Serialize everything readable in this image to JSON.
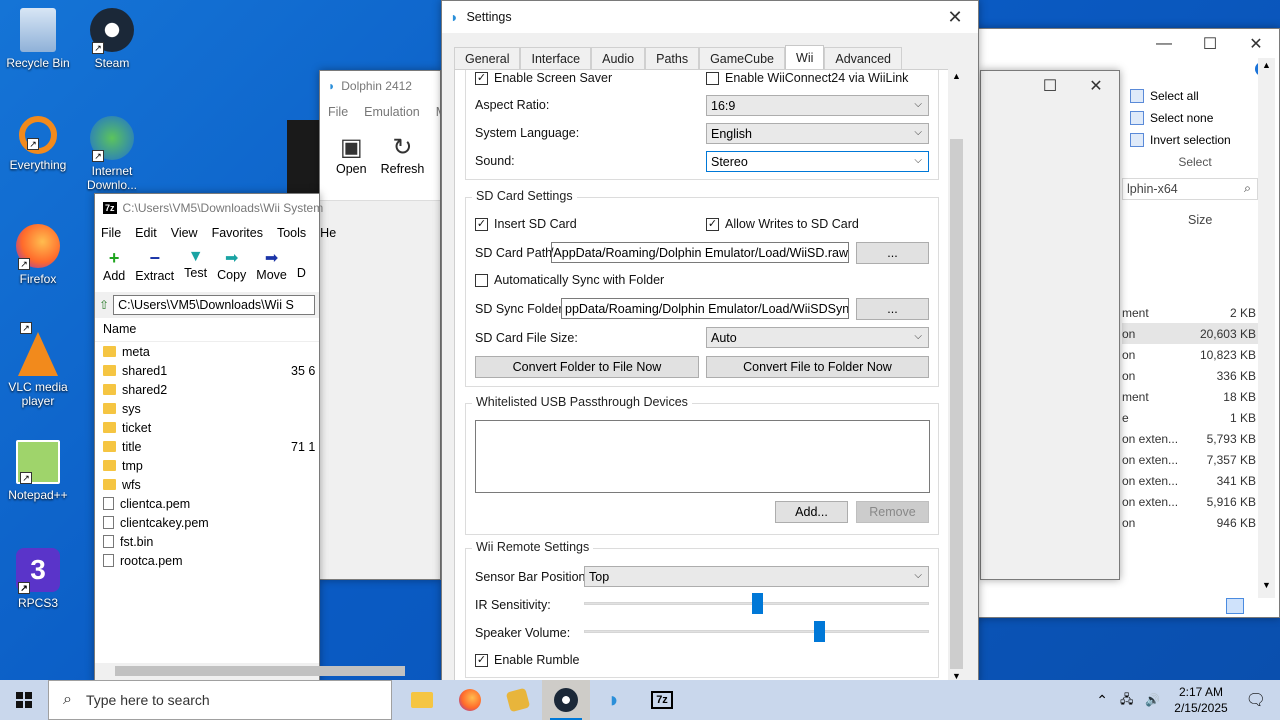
{
  "desktop": {
    "icons": [
      {
        "label": "Recycle Bin",
        "icon": "recycle-bin-icon"
      },
      {
        "label": "Steam",
        "icon": "steam-icon"
      },
      {
        "label": "Everything",
        "icon": "everything-search-icon"
      },
      {
        "label": "Internet Downlo...",
        "icon": "internet-download-manager-icon"
      },
      {
        "label": "Firefox",
        "icon": "firefox-icon"
      },
      {
        "label": "VLC media player",
        "icon": "vlc-icon"
      },
      {
        "label": "Notepad++",
        "icon": "notepad-plus-plus-icon"
      },
      {
        "label": "RPCS3",
        "icon": "rpcs3-icon"
      }
    ]
  },
  "explorer": {
    "ribbon": [
      "Select all",
      "Select none",
      "Invert selection"
    ],
    "ribbon_group": "Select",
    "search_text": "lphin-x64",
    "size_header": "Size",
    "rows": [
      {
        "type": "ment",
        "size": "2 KB"
      },
      {
        "type": "on",
        "size": "20,603 KB"
      },
      {
        "type": "on",
        "size": "10,823 KB"
      },
      {
        "type": "on",
        "size": "336 KB"
      },
      {
        "type": "ment",
        "size": "18 KB"
      },
      {
        "type": "e",
        "size": "1 KB"
      },
      {
        "type": "on exten...",
        "size": "5,793 KB"
      },
      {
        "type": "on exten...",
        "size": "7,357 KB"
      },
      {
        "type": "on exten...",
        "size": "341 KB"
      },
      {
        "type": "on exten...",
        "size": "5,916 KB"
      },
      {
        "type": "on",
        "size": "946 KB"
      }
    ]
  },
  "dolphin": {
    "title": "Dolphin 2412",
    "menu": [
      "File",
      "Emulation",
      "M"
    ],
    "toolbar": [
      "Open",
      "Refresh"
    ]
  },
  "sevenzip": {
    "title": "C:\\Users\\VM5\\Downloads\\Wii System",
    "menu": [
      "File",
      "Edit",
      "View",
      "Favorites",
      "Tools",
      "He"
    ],
    "toolbar": [
      "Add",
      "Extract",
      "Test",
      "Copy",
      "Move",
      "D"
    ],
    "path": "C:\\Users\\VM5\\Downloads\\Wii S",
    "name_header": "Name",
    "files": [
      {
        "name": "meta",
        "folder": true,
        "size": ""
      },
      {
        "name": "shared1",
        "folder": true,
        "size": "35 6"
      },
      {
        "name": "shared2",
        "folder": true,
        "size": ""
      },
      {
        "name": "sys",
        "folder": true,
        "size": ""
      },
      {
        "name": "ticket",
        "folder": true,
        "size": ""
      },
      {
        "name": "title",
        "folder": true,
        "size": "71 1"
      },
      {
        "name": "tmp",
        "folder": true,
        "size": ""
      },
      {
        "name": "wfs",
        "folder": true,
        "size": ""
      },
      {
        "name": "clientca.pem",
        "folder": false,
        "size": ""
      },
      {
        "name": "clientcakey.pem",
        "folder": false,
        "size": ""
      },
      {
        "name": "fst.bin",
        "folder": false,
        "size": ""
      },
      {
        "name": "rootca.pem",
        "folder": false,
        "size": ""
      }
    ]
  },
  "settings": {
    "title": "Settings",
    "tabs": [
      "General",
      "Interface",
      "Audio",
      "Paths",
      "GameCube",
      "Wii",
      "Advanced"
    ],
    "active_tab": "Wii",
    "misc": {
      "screen_saver": "Enable Screen Saver",
      "wiiconnect": "Enable WiiConnect24 via WiiLink",
      "aspect_label": "Aspect Ratio:",
      "aspect_value": "16:9",
      "language_label": "System Language:",
      "language_value": "English",
      "sound_label": "Sound:",
      "sound_value": "Stereo"
    },
    "sd": {
      "title": "SD Card Settings",
      "insert": "Insert SD Card",
      "allow_writes": "Allow Writes to SD Card",
      "path_label": "SD Card Path:",
      "path_value": "/AppData/Roaming/Dolphin Emulator/Load/WiiSD.raw",
      "browse": "...",
      "auto_sync": "Automatically Sync with Folder",
      "sync_label": "SD Sync Folder:",
      "sync_value": "ppData/Roaming/Dolphin Emulator/Load/WiiSDSync/",
      "size_label": "SD Card File Size:",
      "size_value": "Auto",
      "convert_folder": "Convert Folder to File Now",
      "convert_file": "Convert File to Folder Now"
    },
    "usb": {
      "title": "Whitelisted USB Passthrough Devices",
      "add": "Add...",
      "remove": "Remove"
    },
    "remote": {
      "title": "Wii Remote Settings",
      "sensor_label": "Sensor Bar Position:",
      "sensor_value": "Top",
      "ir_label": "IR Sensitivity:",
      "ir_level": 0.5,
      "volume_label": "Speaker Volume:",
      "volume_level": 0.68,
      "rumble": "Enable Rumble"
    }
  },
  "taskbar": {
    "search_placeholder": "Type here to search",
    "time": "2:17 AM",
    "date": "2/15/2025"
  },
  "colors": {
    "accent": "#0078d7",
    "desktop": "#0a5bc4"
  }
}
